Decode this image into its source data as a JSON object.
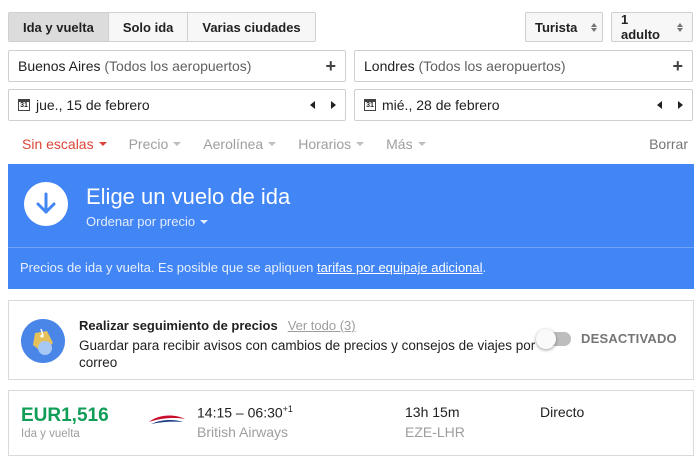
{
  "trip_type": {
    "options": [
      "Ida y vuelta",
      "Solo ida",
      "Varias ciudades"
    ],
    "selected": "Ida y vuelta"
  },
  "cabin_class": "Turista",
  "passengers": "1 adulto",
  "origin": {
    "city": "Buenos Aires",
    "detail": "(Todos los aeropuertos)"
  },
  "destination": {
    "city": "Londres",
    "detail": "(Todos los aeropuertos)"
  },
  "depart_date": "jue., 15 de febrero",
  "return_date": "mié., 28 de febrero",
  "calendar_icon_day": "31",
  "plus_symbol": "+",
  "filters": {
    "items": [
      "Sin escalas",
      "Precio",
      "Aerolínea",
      "Horarios",
      "Más"
    ],
    "active": "Sin escalas",
    "clear_label": "Borrar"
  },
  "banner": {
    "title": "Elige un vuelo de ida",
    "sort_label": "Ordenar por precio",
    "note_prefix": "Precios de ida y vuelta. Es posible que se apliquen ",
    "note_link": "tarifas por equipaje adicional",
    "note_suffix": ".",
    "color": "#4285f4"
  },
  "tracking": {
    "title": "Realizar seguimiento de precios",
    "link": "Ver todo (3)",
    "description": "Guardar para recibir avisos con cambios de precios y consejos de viajes por correo",
    "toggle_label": "DESACTIVADO",
    "toggle_on": false
  },
  "flight": {
    "price": "EUR1,516",
    "price_type": "Ida y vuelta",
    "depart_time": "14:15",
    "time_sep": " – ",
    "arrive_time": "06:30",
    "day_offset": "+1",
    "airline": "British Airways",
    "duration": "13h 15m",
    "route": "EZE-LHR",
    "stops": "Directo",
    "price_color": "#0f9d58"
  }
}
